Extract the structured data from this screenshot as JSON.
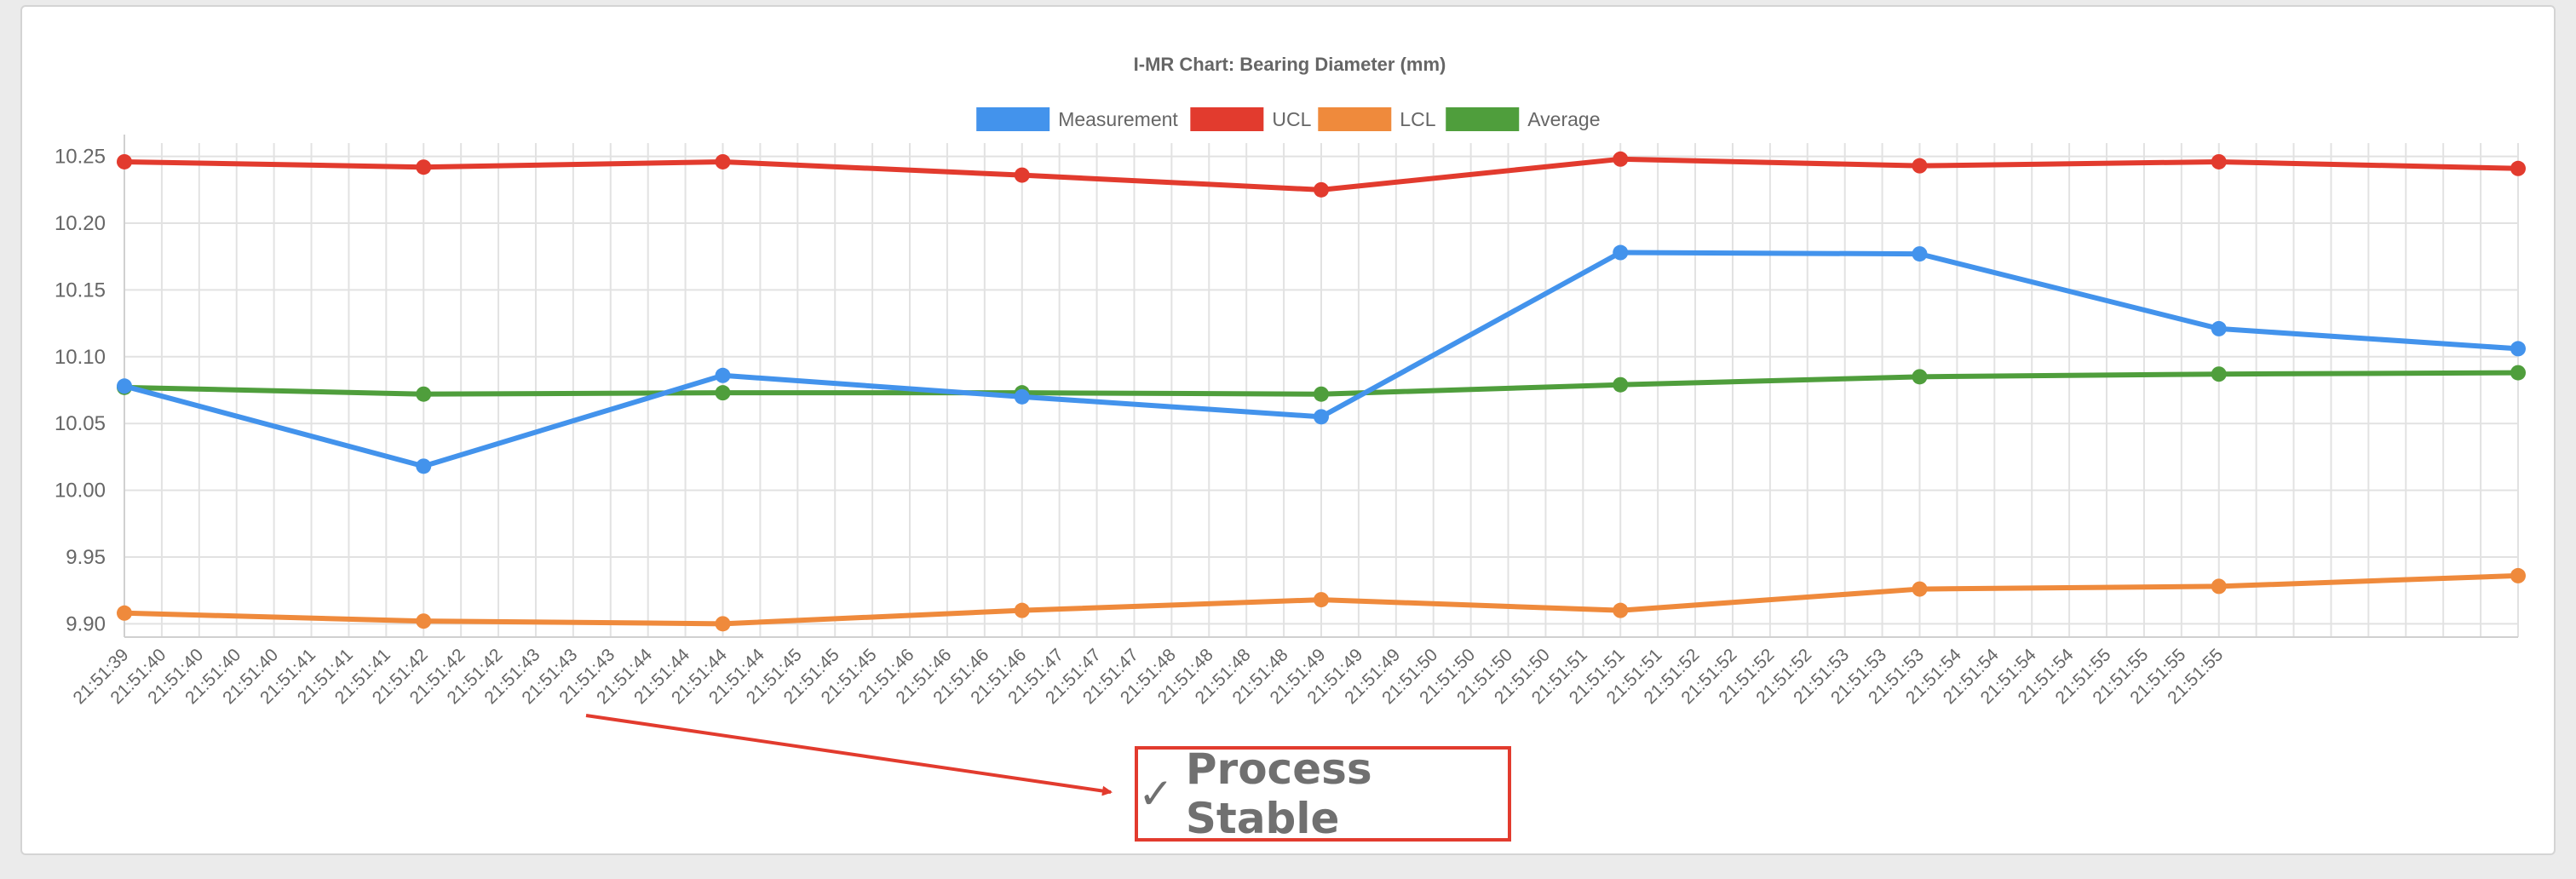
{
  "chart_data": {
    "type": "line",
    "title": "I-MR Chart: Bearing Diameter (mm)",
    "xlabel": "",
    "ylabel": "",
    "ylim": [
      9.89,
      10.26
    ],
    "yticks": [
      9.9,
      9.95,
      10.0,
      10.05,
      10.1,
      10.15,
      10.2,
      10.25
    ],
    "grid": true,
    "legend_position": "top",
    "x": [
      "21:51:39",
      "21:51:40",
      "21:51:40",
      "21:51:40",
      "21:51:40",
      "21:51:41",
      "21:51:41",
      "21:51:41",
      "21:51:42",
      "21:51:42",
      "21:51:42",
      "21:51:43",
      "21:51:43",
      "21:51:43",
      "21:51:44",
      "21:51:44",
      "21:51:44",
      "21:51:44",
      "21:51:45",
      "21:51:45",
      "21:51:45",
      "21:51:46",
      "21:51:46",
      "21:51:46",
      "21:51:46",
      "21:51:47",
      "21:51:47",
      "21:51:47",
      "21:51:48",
      "21:51:48",
      "21:51:48",
      "21:51:48",
      "21:51:49",
      "21:51:49",
      "21:51:49",
      "21:51:50",
      "21:51:50",
      "21:51:50",
      "21:51:50",
      "21:51:51",
      "21:51:51",
      "21:51:51",
      "21:51:52",
      "21:51:52",
      "21:51:52",
      "21:51:52",
      "21:51:53",
      "21:51:53",
      "21:51:53",
      "21:51:54",
      "21:51:54",
      "21:51:54",
      "21:51:54",
      "21:51:55",
      "21:51:55",
      "21:51:55",
      "21:51:55"
    ],
    "point_index": [
      0,
      8,
      16,
      24,
      32,
      40,
      48,
      56,
      64
    ],
    "series": [
      {
        "name": "Measurement",
        "color": "#4393ec",
        "values": [
          10.078,
          10.018,
          10.086,
          10.07,
          10.055,
          10.178,
          10.177,
          10.121,
          10.106
        ]
      },
      {
        "name": "UCL",
        "color": "#e23b2e",
        "values": [
          10.246,
          10.242,
          10.246,
          10.236,
          10.225,
          10.248,
          10.243,
          10.246,
          10.241
        ]
      },
      {
        "name": "LCL",
        "color": "#ef8a3c",
        "values": [
          9.908,
          9.902,
          9.9,
          9.91,
          9.918,
          9.91,
          9.926,
          9.928,
          9.936
        ]
      },
      {
        "name": "Average",
        "color": "#4f9e3c",
        "values": [
          10.077,
          10.072,
          10.073,
          10.073,
          10.072,
          10.079,
          10.085,
          10.087,
          10.088
        ]
      }
    ],
    "annotation": {
      "text": "Process Stable",
      "icon": "check-icon",
      "border_color": "#e23b2e",
      "arrow_color": "#e23b2e"
    }
  },
  "status": {
    "check": "✓",
    "text": "Process Stable"
  }
}
